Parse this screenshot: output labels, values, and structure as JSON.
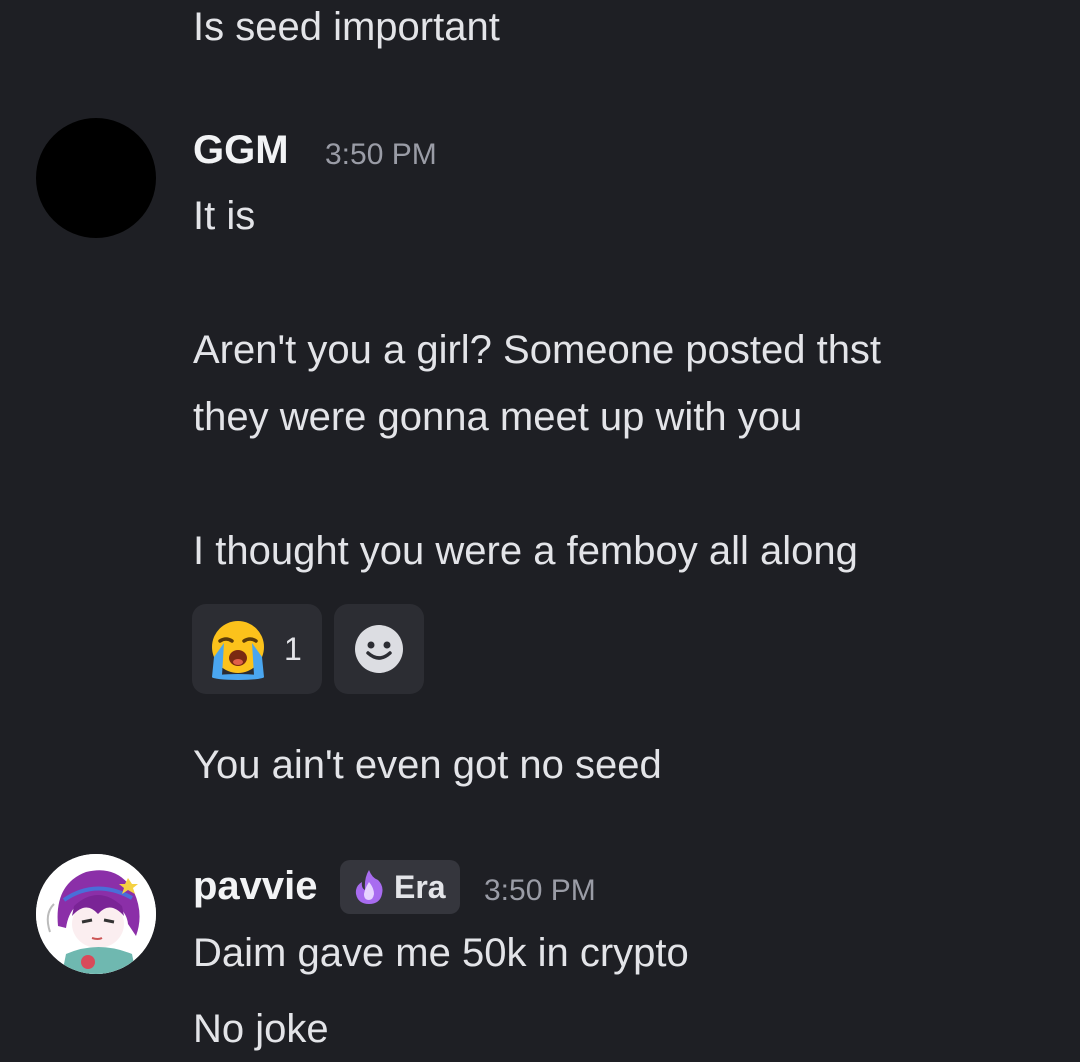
{
  "messages": {
    "previous_line": "Is seed important",
    "ggm": {
      "username": "GGM",
      "timestamp": "3:50 PM",
      "lines": [
        "It is",
        "Aren't you a girl? Someone posted thst",
        "they were gonna meet up with you",
        "I thought you were a femboy all along",
        "You ain't even got no seed"
      ],
      "reactions": [
        {
          "icon": "loudly-crying-face-icon",
          "count": "1"
        },
        {
          "icon": "add-reaction-smiley-icon"
        }
      ]
    },
    "pavvie": {
      "username": "pavvie",
      "badge": {
        "icon": "purple-flame-icon",
        "label": "Era"
      },
      "timestamp": "3:50 PM",
      "lines": [
        "Daim gave me 50k in crypto",
        "No joke"
      ]
    }
  },
  "colors": {
    "background": "#1e1f24",
    "reaction_bg": "#2c2d33",
    "timestamp": "#9a9ca6",
    "badge_bg": "#35363d"
  }
}
